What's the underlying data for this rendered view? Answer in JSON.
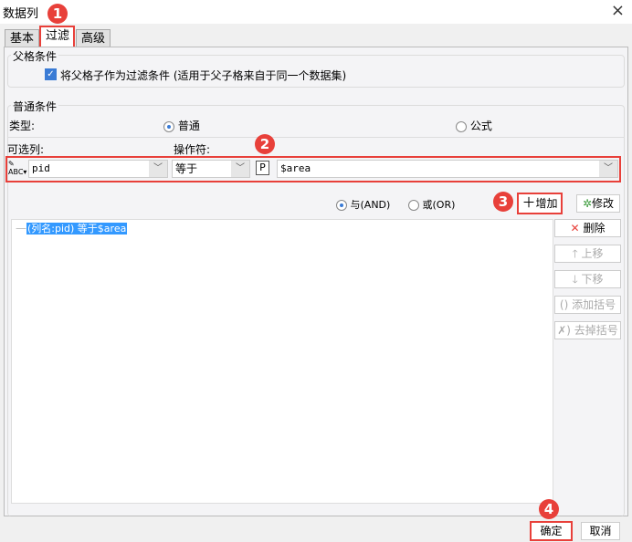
{
  "window": {
    "title": "数据列",
    "close_icon": "×"
  },
  "tabs": [
    {
      "label": "基本"
    },
    {
      "label": "过滤",
      "active": true
    },
    {
      "label": "高级"
    }
  ],
  "parent": {
    "title": "父格条件",
    "checkbox_label": "将父格子作为过滤条件 (适用于父子格来自于同一个数据集)",
    "checked": true
  },
  "normal": {
    "title": "普通条件",
    "type_label": "类型:",
    "type_options": [
      {
        "label": "普通",
        "selected": true
      },
      {
        "label": "公式",
        "selected": false
      }
    ],
    "column_label": "可选列:",
    "operator_label": "操作符:",
    "column_value": "pid",
    "operator_value": "等于",
    "param_icon": "P",
    "value": "$area"
  },
  "logic": {
    "and_label": "与(AND)",
    "or_label": "或(OR)",
    "and_selected": true
  },
  "buttons": {
    "add": "增加",
    "modify": "修改",
    "delete": "删除",
    "up": "上移",
    "down": "下移",
    "add_bracket": "添加括号",
    "remove_bracket": "去掉括号",
    "ok": "确定",
    "cancel": "取消"
  },
  "conditions": [
    {
      "text": "(列名:pid) 等于$area",
      "selected": true
    }
  ],
  "annotations": [
    "1",
    "2",
    "3",
    "4"
  ],
  "colors": {
    "accent": "#e8403a",
    "selection": "#3399ff"
  }
}
